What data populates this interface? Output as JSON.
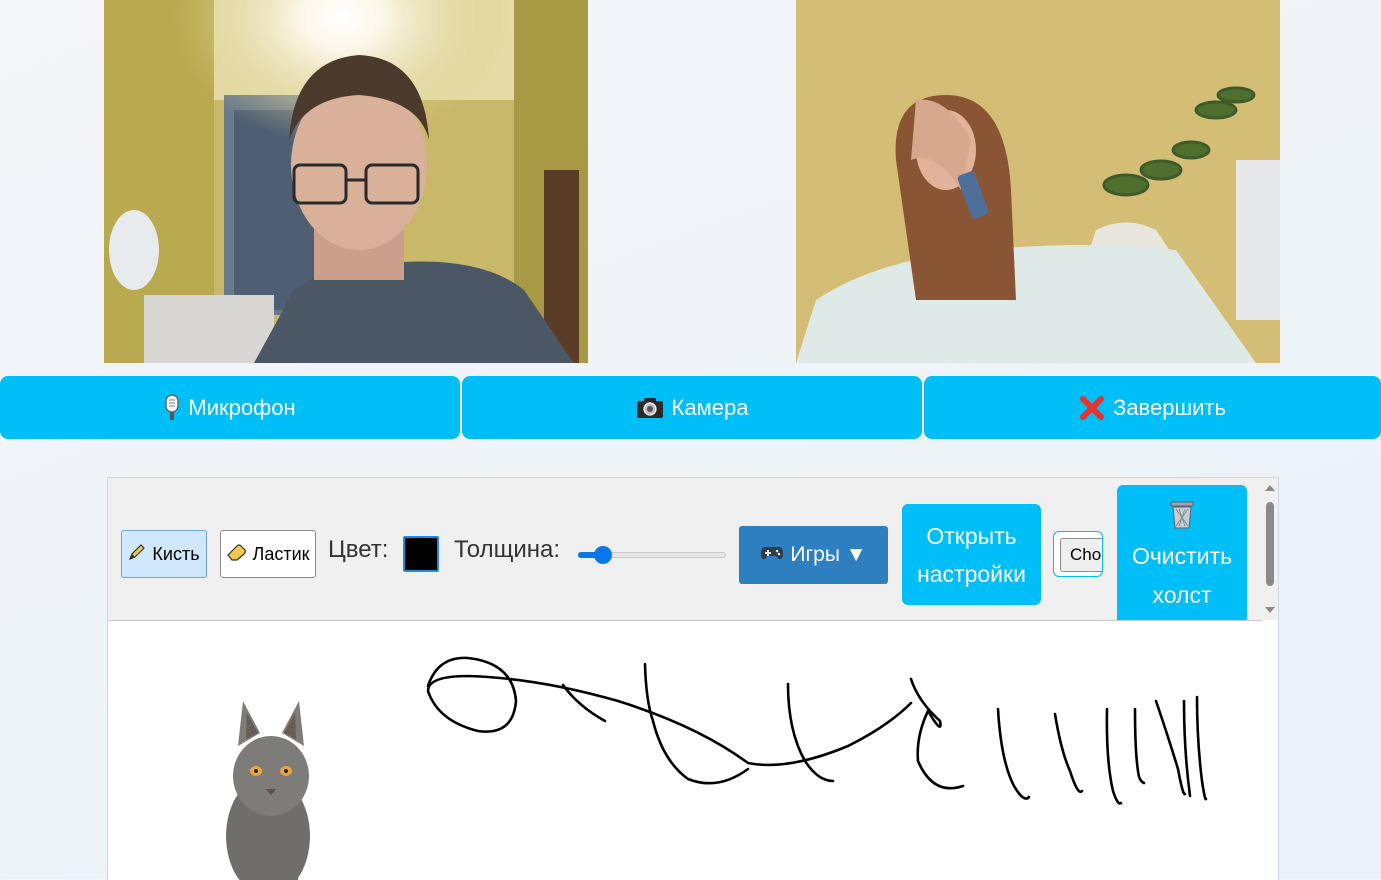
{
  "videos": {
    "local": {
      "label": "local-video"
    },
    "remote": {
      "label": "remote-video"
    }
  },
  "controls": {
    "mic_label": "Микрофон",
    "camera_label": "Камера",
    "end_label": "Завершить",
    "accent": "#00bef8"
  },
  "toolbar": {
    "brush_label": "Кисть",
    "eraser_label": "Ластик",
    "color_label": "Цвет:",
    "color_value": "#000000",
    "thickness_label": "Толщина:",
    "thickness_value": 0.17,
    "games_label": "Игры ▼",
    "settings_label": "Открыть настройки",
    "file_button_label": "Choose File",
    "clear_label": "Очистить холст"
  },
  "canvas": {
    "image": "cat-photo",
    "stroke_color": "#000000"
  }
}
